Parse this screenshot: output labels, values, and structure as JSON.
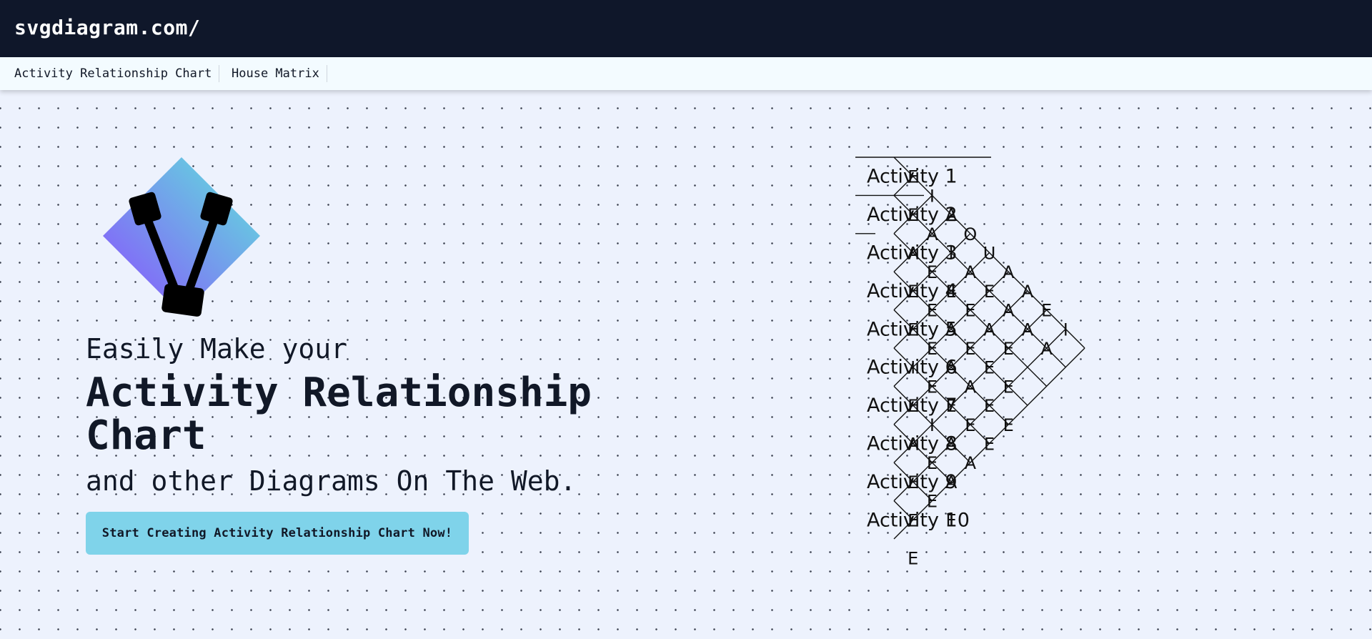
{
  "header": {
    "brand": "svgdiagram.com/"
  },
  "nav": {
    "items": [
      "Activity Relationship Chart",
      "House Matrix"
    ]
  },
  "hero": {
    "tagline": "Easily Make your",
    "headline": "Activity Relationship Chart",
    "subline": "and other Diagrams On The Web.",
    "cta_label": "Start Creating Activity Relationship Chart Now!",
    "logo_colors": {
      "gradient_start": "#5ee6da",
      "gradient_end": "#8b4dff"
    }
  },
  "chart_data": {
    "type": "table",
    "activities": [
      "Activity 1",
      "Activity 2",
      "Activity 3",
      "Activity 4",
      "Activity 5",
      "Activity 6",
      "Activity 7",
      "Activity 8",
      "Activity 9",
      "Activity 10"
    ],
    "relationship_diagonals": [
      [
        "E",
        "E",
        "A",
        "E",
        "E",
        "I",
        "E",
        "A",
        "E",
        "E",
        "E"
      ],
      [
        "I",
        "A",
        "E",
        "E",
        "E",
        "E",
        "I",
        "E",
        "E"
      ],
      [
        "A",
        "I",
        "E",
        "A",
        "A",
        "E",
        "A",
        "A",
        "E"
      ],
      [
        "O",
        "A",
        "E",
        "E",
        "A",
        "E",
        "A"
      ],
      [
        "U",
        "E",
        "A",
        "E",
        "E",
        "E"
      ],
      [
        "A",
        "A",
        "E",
        "E",
        "E"
      ],
      [
        "A",
        "A"
      ],
      [
        "E",
        "A"
      ],
      [
        "I"
      ]
    ]
  }
}
